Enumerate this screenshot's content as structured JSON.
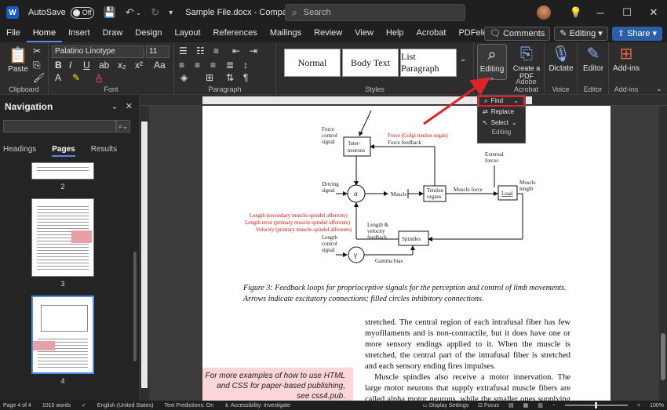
{
  "titlebar": {
    "autosave_label": "AutoSave",
    "autosave_state": "Off",
    "doc_title": "Sample File.docx  -  Compatibility M...",
    "search_placeholder": "Search",
    "logo_letter": "W"
  },
  "menu": {
    "items": [
      "File",
      "Home",
      "Insert",
      "Draw",
      "Design",
      "Layout",
      "References",
      "Mailings",
      "Review",
      "View",
      "Help",
      "Acrobat",
      "PDFelement"
    ],
    "active": "Home",
    "comments_label": "Comments",
    "editing_label": "Editing",
    "share_label": "Share"
  },
  "ribbon": {
    "paste_label": "Paste",
    "clipboard_label": "Clipboard",
    "font_name": "Palatino Linotype",
    "font_size": "11",
    "font_label": "Font",
    "paragraph_label": "Paragraph",
    "styles": [
      "Normal",
      "Body Text",
      "List Paragraph"
    ],
    "styles_label": "Styles",
    "editing_btn_label": "Editing",
    "create_pdf_label": "Create a PDF",
    "adobe_label": "Adobe Acrobat",
    "dictate_label": "Dictate",
    "voice_label": "Voice",
    "editor_btn_label": "Editor",
    "editor_label": "Editor",
    "addins_btn_label": "Add-ins",
    "addins_label": "Add-ins"
  },
  "find_menu": {
    "find": "Find",
    "replace": "Replace",
    "select": "Select",
    "group_label": "Editing"
  },
  "nav": {
    "title": "Navigation",
    "tabs": [
      "Headings",
      "Pages",
      "Results"
    ],
    "active_tab": "Pages",
    "pages": [
      "2",
      "3",
      "4"
    ]
  },
  "diagram": {
    "force_control_signal": [
      "Force",
      "control",
      "signal"
    ],
    "interneurons": [
      "Inter-",
      "neurons"
    ],
    "force_golgi": "Force (Golgi tendon organ)",
    "force_feedback": "Force feedback",
    "external_forces": [
      "External",
      "forces"
    ],
    "driving_signal": [
      "Driving",
      "signal"
    ],
    "alpha": "α",
    "muscle": "Muscle",
    "tendon_organs": [
      "Tendon",
      "organs"
    ],
    "muscle_force": "Muscle force",
    "load": "Load",
    "muscle_length": [
      "Muscle",
      "length"
    ],
    "length_secondary": "Length (secondary muscle-spindel afferents)",
    "length_error": "Length error (primary muscle-spindel afferents)",
    "velocity": "Velocity (primary muscle-spindel afferents)",
    "length_velocity_feedback": [
      "Length &",
      "velocity",
      "feedback"
    ],
    "spindles": "Spindles",
    "length_control_signal": [
      "Length",
      "control",
      "signal"
    ],
    "gamma": "γ",
    "gamma_bias": "Gamma bias"
  },
  "document": {
    "caption": "Figure 3:  Feedback loops for proprioceptive signals for the perception and control of limb movements. Arrows indicate excitatory connections; filled circles inhibitory connections.",
    "paragraph1": "stretched. The central region of each intrafusal fiber has few myofilaments and is non-contractile, but it does have one or more sensory endings applied to it. When the muscle is stretched, the central part of the intrafusal fiber is stretched and each sensory ending fires impulses.",
    "paragraph2": "Muscle spindles also receive a motor innervation. The large motor neurons that supply extrafusal muscle fibers are called alpha motor neurons, while the smaller ones supplying the contractile portions of intrafusal fibers are called gamma neurons. Gamma motor neurons can regu-",
    "pink_note": "For more examples of how to use HTML and CSS for paper-based publishing, see css4.pub."
  },
  "status": {
    "page": "Page 4 of 4",
    "words": "1010 words",
    "language": "English (United States)",
    "predictions": "Text Predictions: On",
    "accessibility": "Accessibility: Investigate",
    "display_settings": "Display Settings",
    "focus": "Focus",
    "zoom": "100%"
  }
}
